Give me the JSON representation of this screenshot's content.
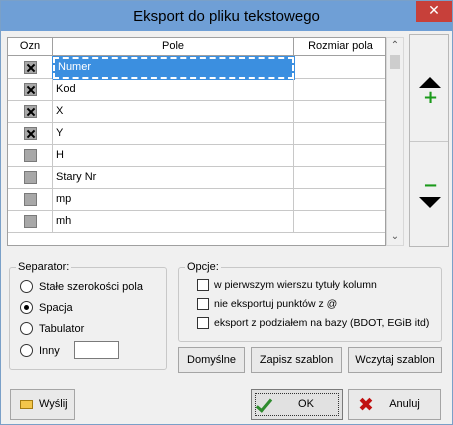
{
  "window": {
    "title": "Eksport do pliku tekstowego",
    "close_label": "✕"
  },
  "grid": {
    "headers": {
      "col1": "Ozn",
      "col2": "Pole",
      "col3": "Rozmiar pola"
    },
    "rows": [
      {
        "checked": true,
        "field": "Numer",
        "size": ""
      },
      {
        "checked": true,
        "field": "Kod",
        "size": ""
      },
      {
        "checked": true,
        "field": "X",
        "size": ""
      },
      {
        "checked": true,
        "field": "Y",
        "size": ""
      },
      {
        "checked": false,
        "field": "H",
        "size": ""
      },
      {
        "checked": false,
        "field": "Stary Nr",
        "size": ""
      },
      {
        "checked": false,
        "field": "mp",
        "size": ""
      },
      {
        "checked": false,
        "field": "mh",
        "size": ""
      }
    ],
    "selected_row": 0
  },
  "scrollbar": {
    "up_arrow": "⌃",
    "down_arrow": "⌄"
  },
  "move": {
    "plus": "+",
    "minus": "−"
  },
  "separator": {
    "legend": "Separator:",
    "options": [
      "Stałe szerokości pola",
      "Spacja",
      "Tabulator",
      "Inny"
    ],
    "selected": 1,
    "other_value": ""
  },
  "options": {
    "legend": "Opcje:",
    "items": [
      {
        "label": "w pierwszym wierszu tytuły kolumn",
        "checked": false
      },
      {
        "label": "nie eksportuj punktów z @",
        "checked": false
      },
      {
        "label": "eksport z podziałem na bazy (BDOT, EGiB itd)",
        "checked": false
      }
    ]
  },
  "buttons": {
    "defaults": "Domyślne",
    "save_template": "Zapisz szablon",
    "load_template": "Wczytaj szablon",
    "send": "Wyślij",
    "ok": "OK",
    "cancel": "Anuluj"
  },
  "colors": {
    "titlebar": "#6f9fd6",
    "selection": "#3b8fe0",
    "plus": "#1a9a1a",
    "cancel_x": "#c01010"
  }
}
